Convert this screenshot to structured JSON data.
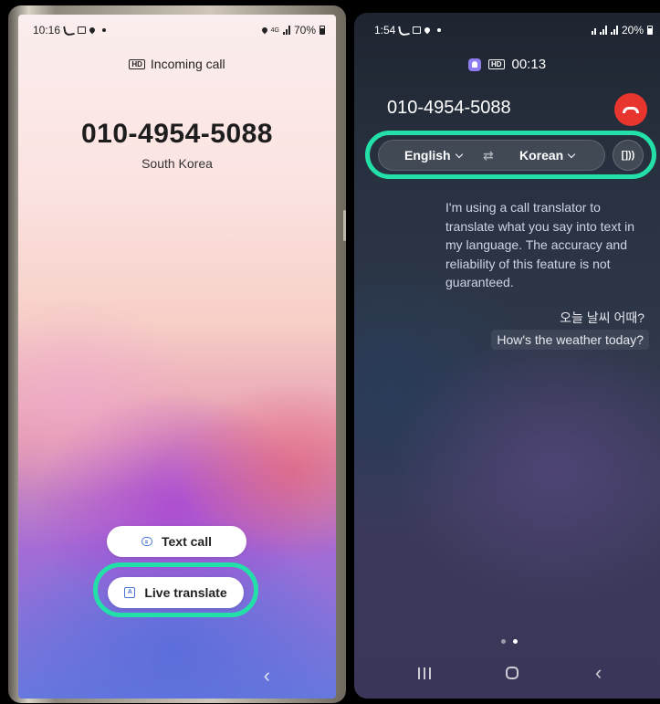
{
  "left_phone": {
    "status": {
      "time": "10:16",
      "network": "4G",
      "battery": "70%"
    },
    "incoming_label": "Incoming call",
    "hd_badge": "HD",
    "phone_number": "010-4954-5088",
    "country": "South Korea",
    "text_call_label": "Text call",
    "live_translate_label": "Live translate",
    "back_symbol": "‹"
  },
  "right_phone": {
    "status": {
      "time": "1:54",
      "battery": "20%"
    },
    "hd_badge": "HD",
    "call_timer": "00:13",
    "phone_number": "010-4954-5088",
    "source_language": "English",
    "target_language": "Korean",
    "swap_symbol": "⇄",
    "speaker_label": "[]))",
    "notice": "I'm using a call translator to translate what you say into text in my language. The accuracy and reliability of this feature is not guaranteed.",
    "original_message": "오늘 날씨 어때?",
    "translated_message": "How's the weather today?",
    "back_symbol": "‹"
  },
  "colors": {
    "highlight": "#22e0a8",
    "end_call": "#e8352e",
    "icon_blue": "#4a74d8"
  }
}
